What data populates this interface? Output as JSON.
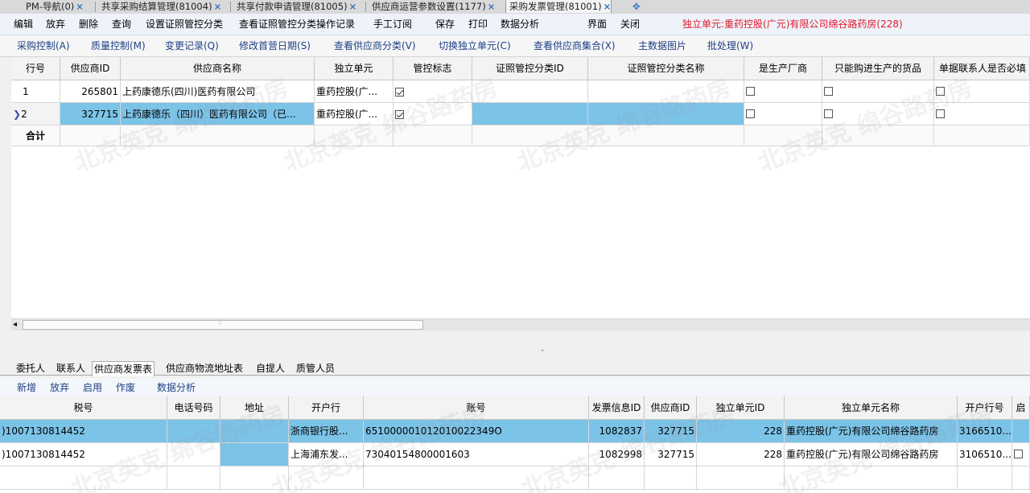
{
  "tabs": [
    {
      "label": "PM-导航(0)",
      "active": false
    },
    {
      "label": "共享采购结算管理(81004)",
      "active": false
    },
    {
      "label": "共享付款申请管理(81005)",
      "active": false
    },
    {
      "label": "供应商运营参数设置(1177)",
      "active": false
    },
    {
      "label": "采购发票管理(81001)",
      "active": true
    }
  ],
  "tab_add_icon": "plus-icon",
  "menu": {
    "items": [
      "编辑",
      "放弃",
      "删除",
      "查询",
      "设置证照管控分类",
      "查看证照管控分类操作记录",
      "手工订阅",
      "保存",
      "打印",
      "数据分析",
      "界面",
      "关闭"
    ],
    "unit_label": "独立单元:重药控股(广元)有限公司绵谷路药房(228)"
  },
  "toolbar": [
    "采购控制(A)",
    "质量控制(M)",
    "变更记录(Q)",
    "修改首营日期(S)",
    "查看供应商分类(V)",
    "切换独立单元(C)",
    "查看供应商集合(X)",
    "主数据图片",
    "批处理(W)"
  ],
  "top_grid": {
    "columns": [
      "行号",
      "供应商ID",
      "供应商名称",
      "独立单元",
      "管控标志",
      "证照管控分类ID",
      "证照管控分类名称",
      "是生产厂商",
      "只能购进生产的货品",
      "单据联系人是否必填"
    ],
    "rows": [
      {
        "row_no": "1",
        "supplier_id": "265801",
        "supplier_name": "上药康德乐(四川)医药有限公司",
        "unit": "重药控股(广...",
        "control": true,
        "cert_id": "",
        "cert_name": "",
        "is_mfr": false,
        "only_mfr": false,
        "contact_req": false
      },
      {
        "row_no": "2",
        "supplier_id": "327715",
        "supplier_name": "上药康德乐（四川）医药有限公司（已...",
        "unit": "重药控股(广...",
        "control": true,
        "cert_id": "",
        "cert_name": "",
        "is_mfr": false,
        "only_mfr": false,
        "contact_req": false
      }
    ],
    "total_label": "合计"
  },
  "bottom_tabs": [
    "委托人",
    "联系人",
    "供应商发票表",
    "供应商物流地址表",
    "自提人",
    "质管人员"
  ],
  "bottom_tab_active": "供应商发票表",
  "bottom_toolbar": [
    "新增",
    "放弃",
    "启用",
    "作废",
    "数据分析"
  ],
  "bottom_grid": {
    "columns": [
      "税号",
      "电话号码",
      "地址",
      "开户行",
      "账号",
      "发票信息ID",
      "供应商ID",
      "独立单元ID",
      "独立单元名称",
      "开户行号",
      "启"
    ],
    "rows": [
      {
        "tax_no": ")1007130814452",
        "phone": "",
        "address": "",
        "bank": "浙商银行股...",
        "account": "651000001012010022349O",
        "invoice_id": "1082837",
        "supplier_id": "327715",
        "unit_id": "228",
        "unit_name": "重药控股(广元)有限公司绵谷路药房",
        "bank_no": "3166510...",
        "enabled": false
      },
      {
        "tax_no": ")1007130814452",
        "phone": "",
        "address": "",
        "bank": "上海浦东发...",
        "account": "73040154800001603",
        "invoice_id": "1082998",
        "supplier_id": "327715",
        "unit_id": "228",
        "unit_name": "重药控股(广元)有限公司绵谷路药房",
        "bank_no": "3106510...",
        "enabled": false
      }
    ]
  },
  "watermark": "北京英克 绵谷路药房"
}
